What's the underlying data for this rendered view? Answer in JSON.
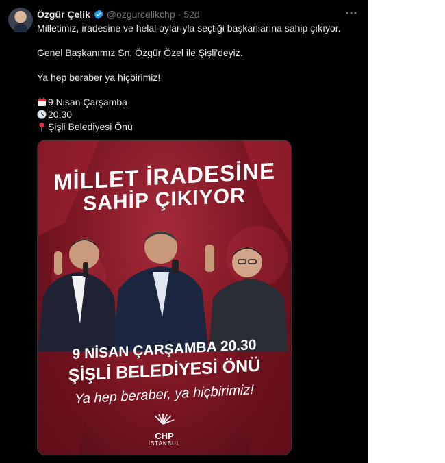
{
  "tweet": {
    "author_name": "Özgür Çelik",
    "handle": "@ozgurcelikchp",
    "separator": "·",
    "time": "52d",
    "lines": [
      "Milletimiz, iradesine ve helal oylarıyla seçtiği başkanlarına sahip çıkıyor.",
      "Genel Başkanımız Sn. Özgür Özel ile Şişli'deyiz.",
      "Ya hep beraber ya hiçbirimiz!"
    ],
    "event": {
      "date": "9 Nisan Çarşamba",
      "time": "20.30",
      "place": "Şişli Belediyesi Önü"
    },
    "icons": {
      "avatar": "avatar-photo",
      "verified": "verified-badge-icon",
      "more": "more-options-icon",
      "calendar": "calendar-icon",
      "clock": "clock-icon",
      "pin": "pushpin-icon"
    }
  },
  "poster": {
    "headline_line1": "MİLLET İRADESİNE",
    "headline_line2": "SAHİP ÇIKIYOR",
    "date_line": "9 NİSAN ÇARŞAMBA 20.30",
    "place_line": "ŞİŞLİ BELEDİYESİ ÖNÜ",
    "slogan": "Ya hep beraber, ya hiçbirimiz!",
    "logo_text": "CHP",
    "logo_sub": "İSTANBUL"
  },
  "colors": {
    "background": "#000000",
    "text": "#e7e9ea",
    "muted": "#71767b",
    "verified": "#1d9bf0",
    "poster_red": "#8b1a28"
  }
}
